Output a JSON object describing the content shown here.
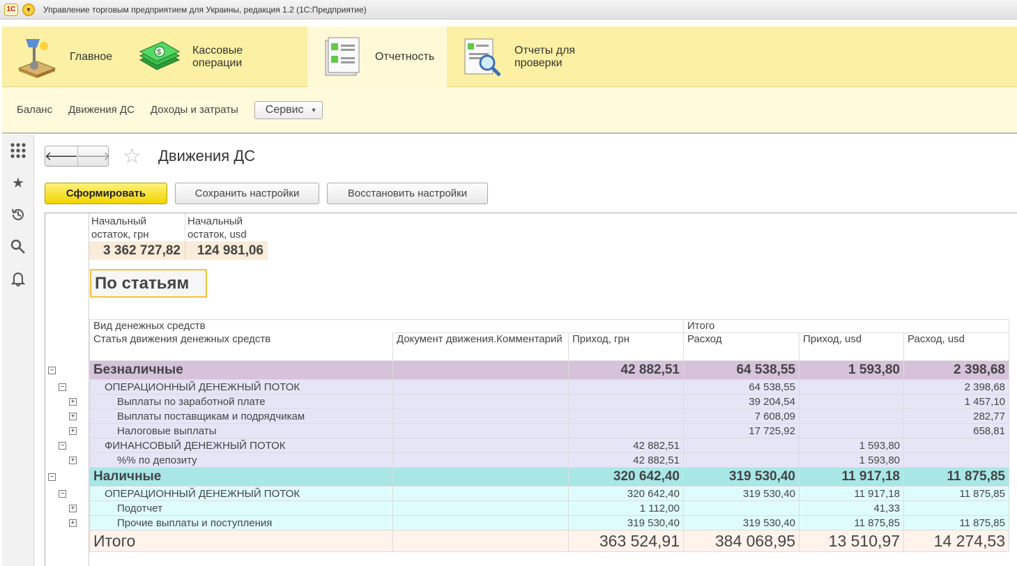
{
  "window": {
    "title": "Управление торговым предприятием для Украины, редакция 1.2  (1С:Предприятие)",
    "logo_text": "1С"
  },
  "sections": [
    {
      "label": "Главное",
      "icon": "desk-lamp-icon"
    },
    {
      "label": "Кассовые операции",
      "icon": "money-icon"
    },
    {
      "label": "Отчетность",
      "icon": "report-icon",
      "active": true
    },
    {
      "label": "Отчеты для проверки",
      "icon": "report-search-icon"
    }
  ],
  "submenu": {
    "items": [
      "Баланс",
      "Движения ДС",
      "Доходы и затраты"
    ],
    "service_label": "Сервис"
  },
  "page": {
    "title": "Движения ДС",
    "btn_generate": "Сформировать",
    "btn_save": "Сохранить настройки",
    "btn_restore": "Восстановить настройки"
  },
  "balance": {
    "uah_head": "Начальный остаток, грн",
    "usd_head": "Начальный остаток, usd",
    "uah_value": "3 362 727,82",
    "usd_value": "124 981,06"
  },
  "group_title": "По статьям",
  "table": {
    "h_type": "Вид денежных средств",
    "h_total": "Итого",
    "h_article": "Статья движения денежных средств",
    "h_doc": "Документ движения.Комментарий",
    "h_in_uah": "Приход, грн",
    "h_out_uah": "Расход",
    "h_in_usd": "Приход, usd",
    "h_out_usd": "Расход, usd",
    "rows": [
      {
        "kind": "g1",
        "label": "Безналичные",
        "in_uah": "42 882,51",
        "out_uah": "64 538,55",
        "in_usd": "1 593,80",
        "out_usd": "2 398,68"
      },
      {
        "kind": "r1",
        "level": 1,
        "label": "ОПЕРАЦИОННЫЙ ДЕНЕЖНЫЙ ПОТОК",
        "in_uah": "",
        "out_uah": "64 538,55",
        "in_usd": "",
        "out_usd": "2 398,68"
      },
      {
        "kind": "r1",
        "level": 2,
        "label": "Выплаты по заработной плате",
        "in_uah": "",
        "out_uah": "39 204,54",
        "in_usd": "",
        "out_usd": "1 457,10"
      },
      {
        "kind": "r1",
        "level": 2,
        "label": "Выплаты поставщикам и подрядчикам",
        "in_uah": "",
        "out_uah": "7 608,09",
        "in_usd": "",
        "out_usd": "282,77"
      },
      {
        "kind": "r1",
        "level": 2,
        "label": "Налоговые выплаты",
        "in_uah": "",
        "out_uah": "17 725,92",
        "in_usd": "",
        "out_usd": "658,81"
      },
      {
        "kind": "r1",
        "level": 1,
        "label": "ФИНАНСОВЫЙ ДЕНЕЖНЫЙ ПОТОК",
        "in_uah": "42 882,51",
        "out_uah": "",
        "in_usd": "1 593,80",
        "out_usd": ""
      },
      {
        "kind": "r1",
        "level": 2,
        "label": "%% по депозиту",
        "in_uah": "42 882,51",
        "out_uah": "",
        "in_usd": "1 593,80",
        "out_usd": ""
      },
      {
        "kind": "g2",
        "label": "Наличные",
        "in_uah": "320 642,40",
        "out_uah": "319 530,40",
        "in_usd": "11 917,18",
        "out_usd": "11 875,85"
      },
      {
        "kind": "r2",
        "level": 1,
        "label": "ОПЕРАЦИОННЫЙ ДЕНЕЖНЫЙ ПОТОК",
        "in_uah": "320 642,40",
        "out_uah": "319 530,40",
        "in_usd": "11 917,18",
        "out_usd": "11 875,85"
      },
      {
        "kind": "r2",
        "level": 2,
        "label": "Подотчет",
        "in_uah": "1 112,00",
        "out_uah": "",
        "in_usd": "41,33",
        "out_usd": ""
      },
      {
        "kind": "r2",
        "level": 2,
        "label": "Прочие выплаты и поступления",
        "in_uah": "319 530,40",
        "out_uah": "319 530,40",
        "in_usd": "11 875,85",
        "out_usd": "11 875,85"
      },
      {
        "kind": "tot",
        "label": "Итого",
        "in_uah": "363 524,91",
        "out_uah": "384 068,95",
        "in_usd": "13 510,97",
        "out_usd": "14 274,53"
      }
    ]
  },
  "left_toolbar": [
    "apps-grid-icon",
    "star-icon",
    "history-icon",
    "search-icon",
    "bell-icon"
  ],
  "colors": {
    "sections_bg": "#fbf0a3",
    "primary_button": "#f2d400",
    "group1_row": "#d6c2da",
    "group2_row": "#a9e7e7",
    "total_row": "#fff3ec"
  }
}
